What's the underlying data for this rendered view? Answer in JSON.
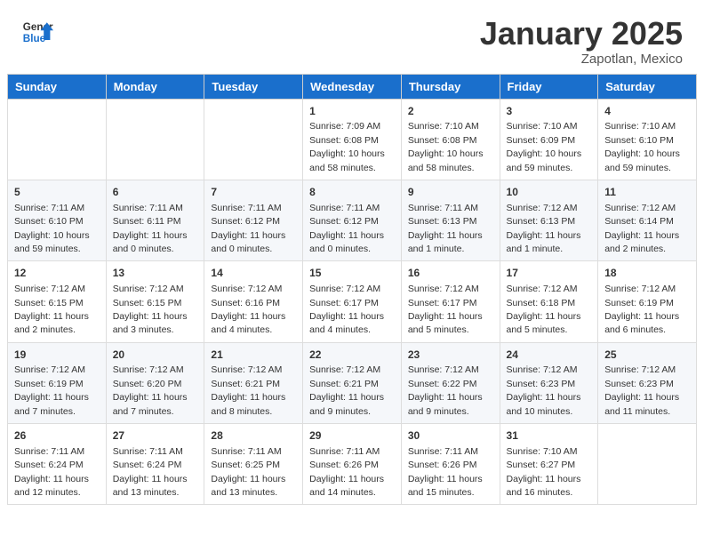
{
  "header": {
    "logo_general": "General",
    "logo_blue": "Blue",
    "month_title": "January 2025",
    "location": "Zapotlan, Mexico"
  },
  "days_of_week": [
    "Sunday",
    "Monday",
    "Tuesday",
    "Wednesday",
    "Thursday",
    "Friday",
    "Saturday"
  ],
  "weeks": [
    [
      {
        "day": "",
        "sunrise": "",
        "sunset": "",
        "daylight": ""
      },
      {
        "day": "",
        "sunrise": "",
        "sunset": "",
        "daylight": ""
      },
      {
        "day": "",
        "sunrise": "",
        "sunset": "",
        "daylight": ""
      },
      {
        "day": "1",
        "sunrise": "Sunrise: 7:09 AM",
        "sunset": "Sunset: 6:08 PM",
        "daylight": "Daylight: 10 hours and 58 minutes."
      },
      {
        "day": "2",
        "sunrise": "Sunrise: 7:10 AM",
        "sunset": "Sunset: 6:08 PM",
        "daylight": "Daylight: 10 hours and 58 minutes."
      },
      {
        "day": "3",
        "sunrise": "Sunrise: 7:10 AM",
        "sunset": "Sunset: 6:09 PM",
        "daylight": "Daylight: 10 hours and 59 minutes."
      },
      {
        "day": "4",
        "sunrise": "Sunrise: 7:10 AM",
        "sunset": "Sunset: 6:10 PM",
        "daylight": "Daylight: 10 hours and 59 minutes."
      }
    ],
    [
      {
        "day": "5",
        "sunrise": "Sunrise: 7:11 AM",
        "sunset": "Sunset: 6:10 PM",
        "daylight": "Daylight: 10 hours and 59 minutes."
      },
      {
        "day": "6",
        "sunrise": "Sunrise: 7:11 AM",
        "sunset": "Sunset: 6:11 PM",
        "daylight": "Daylight: 11 hours and 0 minutes."
      },
      {
        "day": "7",
        "sunrise": "Sunrise: 7:11 AM",
        "sunset": "Sunset: 6:12 PM",
        "daylight": "Daylight: 11 hours and 0 minutes."
      },
      {
        "day": "8",
        "sunrise": "Sunrise: 7:11 AM",
        "sunset": "Sunset: 6:12 PM",
        "daylight": "Daylight: 11 hours and 0 minutes."
      },
      {
        "day": "9",
        "sunrise": "Sunrise: 7:11 AM",
        "sunset": "Sunset: 6:13 PM",
        "daylight": "Daylight: 11 hours and 1 minute."
      },
      {
        "day": "10",
        "sunrise": "Sunrise: 7:12 AM",
        "sunset": "Sunset: 6:13 PM",
        "daylight": "Daylight: 11 hours and 1 minute."
      },
      {
        "day": "11",
        "sunrise": "Sunrise: 7:12 AM",
        "sunset": "Sunset: 6:14 PM",
        "daylight": "Daylight: 11 hours and 2 minutes."
      }
    ],
    [
      {
        "day": "12",
        "sunrise": "Sunrise: 7:12 AM",
        "sunset": "Sunset: 6:15 PM",
        "daylight": "Daylight: 11 hours and 2 minutes."
      },
      {
        "day": "13",
        "sunrise": "Sunrise: 7:12 AM",
        "sunset": "Sunset: 6:15 PM",
        "daylight": "Daylight: 11 hours and 3 minutes."
      },
      {
        "day": "14",
        "sunrise": "Sunrise: 7:12 AM",
        "sunset": "Sunset: 6:16 PM",
        "daylight": "Daylight: 11 hours and 4 minutes."
      },
      {
        "day": "15",
        "sunrise": "Sunrise: 7:12 AM",
        "sunset": "Sunset: 6:17 PM",
        "daylight": "Daylight: 11 hours and 4 minutes."
      },
      {
        "day": "16",
        "sunrise": "Sunrise: 7:12 AM",
        "sunset": "Sunset: 6:17 PM",
        "daylight": "Daylight: 11 hours and 5 minutes."
      },
      {
        "day": "17",
        "sunrise": "Sunrise: 7:12 AM",
        "sunset": "Sunset: 6:18 PM",
        "daylight": "Daylight: 11 hours and 5 minutes."
      },
      {
        "day": "18",
        "sunrise": "Sunrise: 7:12 AM",
        "sunset": "Sunset: 6:19 PM",
        "daylight": "Daylight: 11 hours and 6 minutes."
      }
    ],
    [
      {
        "day": "19",
        "sunrise": "Sunrise: 7:12 AM",
        "sunset": "Sunset: 6:19 PM",
        "daylight": "Daylight: 11 hours and 7 minutes."
      },
      {
        "day": "20",
        "sunrise": "Sunrise: 7:12 AM",
        "sunset": "Sunset: 6:20 PM",
        "daylight": "Daylight: 11 hours and 7 minutes."
      },
      {
        "day": "21",
        "sunrise": "Sunrise: 7:12 AM",
        "sunset": "Sunset: 6:21 PM",
        "daylight": "Daylight: 11 hours and 8 minutes."
      },
      {
        "day": "22",
        "sunrise": "Sunrise: 7:12 AM",
        "sunset": "Sunset: 6:21 PM",
        "daylight": "Daylight: 11 hours and 9 minutes."
      },
      {
        "day": "23",
        "sunrise": "Sunrise: 7:12 AM",
        "sunset": "Sunset: 6:22 PM",
        "daylight": "Daylight: 11 hours and 9 minutes."
      },
      {
        "day": "24",
        "sunrise": "Sunrise: 7:12 AM",
        "sunset": "Sunset: 6:23 PM",
        "daylight": "Daylight: 11 hours and 10 minutes."
      },
      {
        "day": "25",
        "sunrise": "Sunrise: 7:12 AM",
        "sunset": "Sunset: 6:23 PM",
        "daylight": "Daylight: 11 hours and 11 minutes."
      }
    ],
    [
      {
        "day": "26",
        "sunrise": "Sunrise: 7:11 AM",
        "sunset": "Sunset: 6:24 PM",
        "daylight": "Daylight: 11 hours and 12 minutes."
      },
      {
        "day": "27",
        "sunrise": "Sunrise: 7:11 AM",
        "sunset": "Sunset: 6:24 PM",
        "daylight": "Daylight: 11 hours and 13 minutes."
      },
      {
        "day": "28",
        "sunrise": "Sunrise: 7:11 AM",
        "sunset": "Sunset: 6:25 PM",
        "daylight": "Daylight: 11 hours and 13 minutes."
      },
      {
        "day": "29",
        "sunrise": "Sunrise: 7:11 AM",
        "sunset": "Sunset: 6:26 PM",
        "daylight": "Daylight: 11 hours and 14 minutes."
      },
      {
        "day": "30",
        "sunrise": "Sunrise: 7:11 AM",
        "sunset": "Sunset: 6:26 PM",
        "daylight": "Daylight: 11 hours and 15 minutes."
      },
      {
        "day": "31",
        "sunrise": "Sunrise: 7:10 AM",
        "sunset": "Sunset: 6:27 PM",
        "daylight": "Daylight: 11 hours and 16 minutes."
      },
      {
        "day": "",
        "sunrise": "",
        "sunset": "",
        "daylight": ""
      }
    ]
  ]
}
